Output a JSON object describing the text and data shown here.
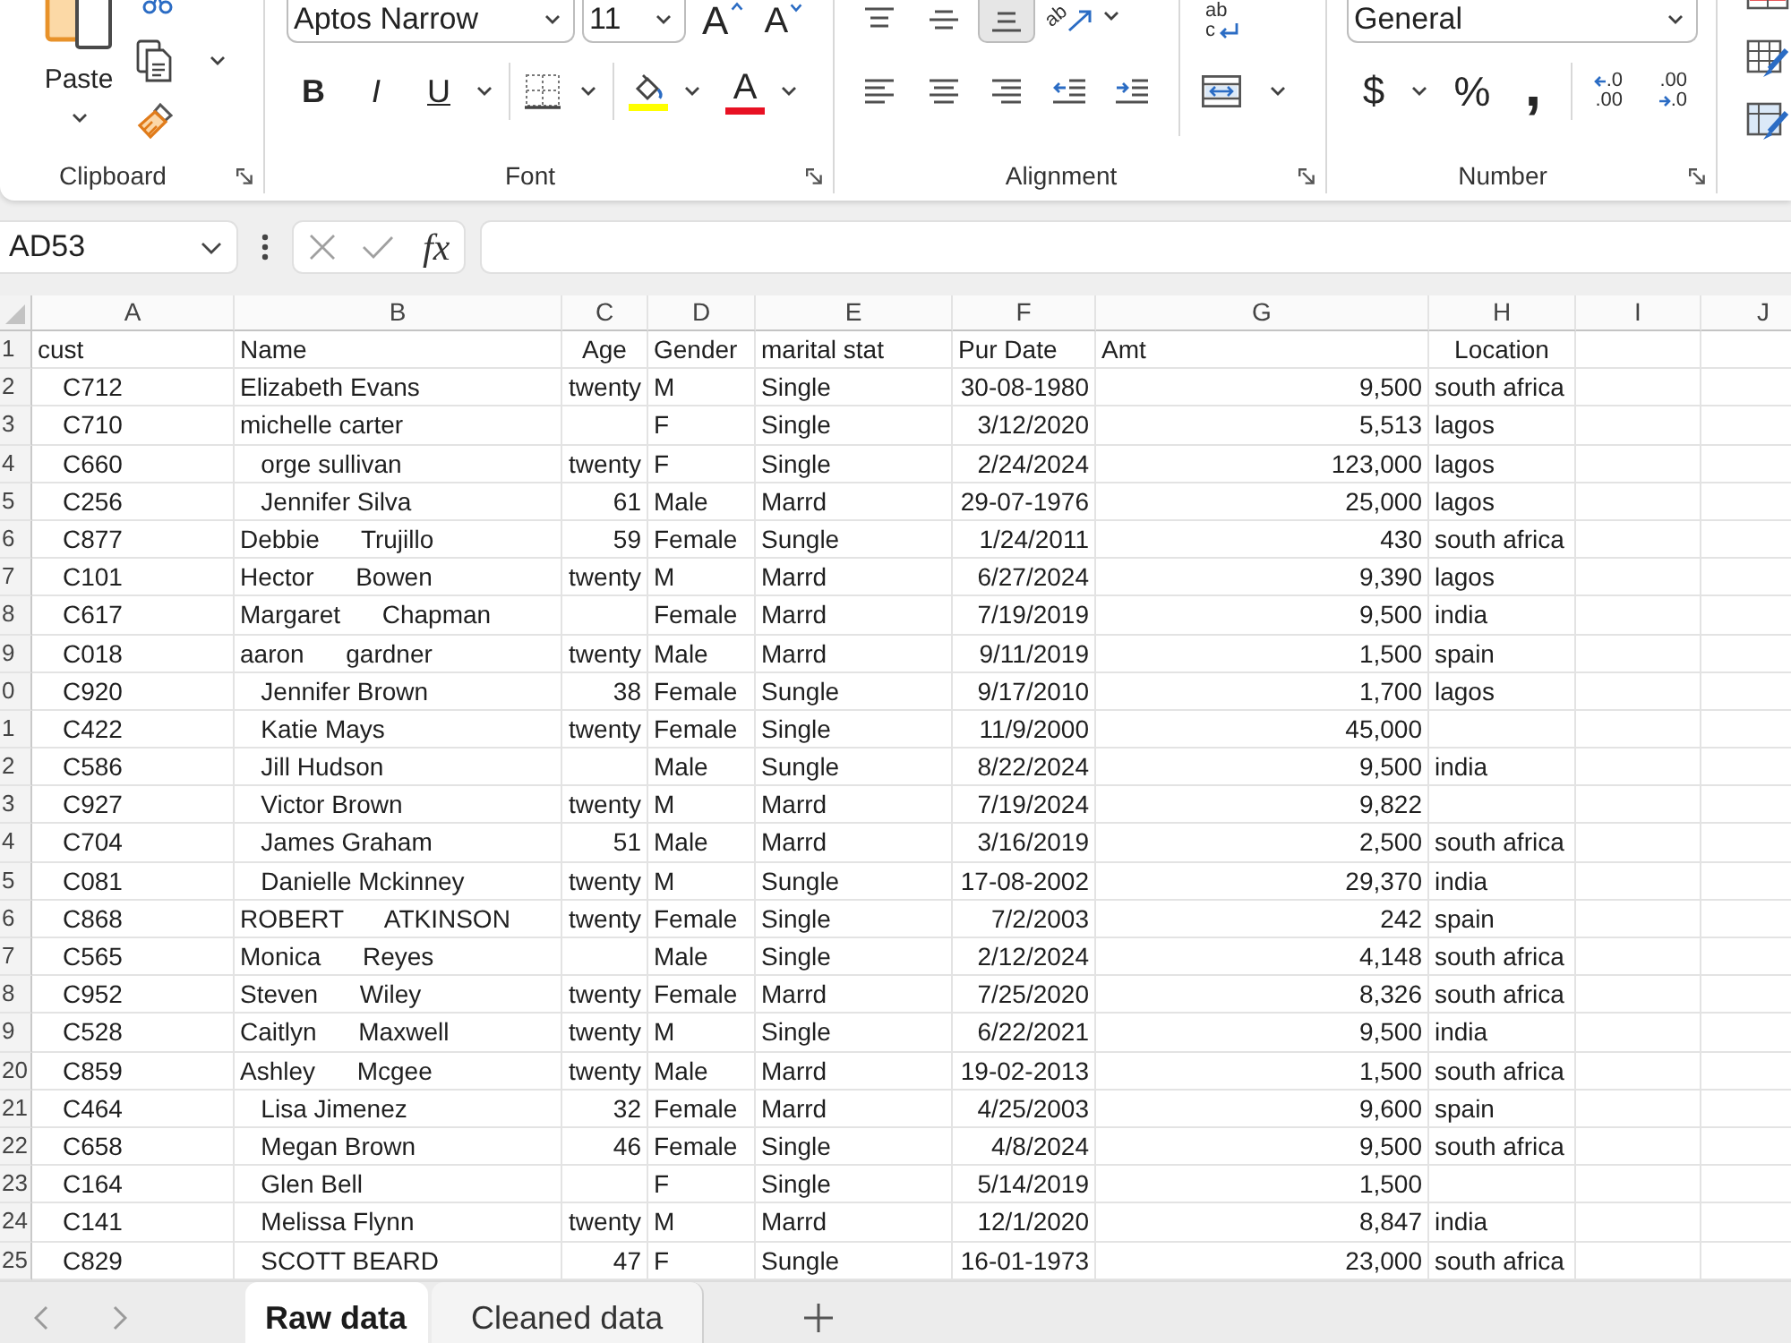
{
  "ribbon": {
    "clipboard": {
      "paste": "Paste",
      "label": "Clipboard"
    },
    "font": {
      "font_name": "Aptos Narrow",
      "font_size": "11",
      "grow_font": "A",
      "shrink_font": "A",
      "bold": "B",
      "italic": "I",
      "underline": "U",
      "font_color": "A",
      "label": "Font"
    },
    "alignment": {
      "vertical": [
        {
          "kind": "top",
          "selected": false
        },
        {
          "kind": "middle",
          "selected": false
        },
        {
          "kind": "bottom",
          "selected": true
        }
      ],
      "orientation": "ab",
      "wrap_text": [
        "ab",
        "c"
      ],
      "horizontal": [
        {
          "kind": "left",
          "selected": false
        },
        {
          "kind": "center",
          "selected": false
        },
        {
          "kind": "right",
          "selected": false
        }
      ],
      "label": "Alignment"
    },
    "number": {
      "format": "General",
      "currency": "$",
      "percent": "%",
      "comma": ",",
      "increase_decimal": [
        ".0",
        ".00"
      ],
      "decrease_decimal": [
        ".00",
        ".0"
      ],
      "label": "Number"
    }
  },
  "formula_bar": {
    "name_box": "AD53",
    "insert_function": "fx"
  },
  "sheet": {
    "columns": [
      "A",
      "B",
      "C",
      "D",
      "E",
      "F",
      "G",
      "H",
      "I",
      "J"
    ],
    "rows": [
      {
        "row": "1",
        "cells": {
          "A": "cust",
          "B": "Name",
          "C": "Age",
          "D": "Gender",
          "E": "marital stat",
          "F": "Pur Date",
          "G": "Amt",
          "H": "Location"
        }
      },
      {
        "row": "2",
        "cells": {
          "A": "C712",
          "B": "Elizabeth Evans",
          "C": "twenty",
          "D": "M",
          "E": "Single",
          "F": "30-08-1980",
          "G": "9,500",
          "H": "south africa"
        }
      },
      {
        "row": "3",
        "cells": {
          "A": "C710",
          "B": "michelle carter",
          "D": "F",
          "E": "Single",
          "F": "3/12/2020",
          "G": "5,513",
          "H": "lagos"
        }
      },
      {
        "row": "4",
        "cells": {
          "A": "C660",
          "B": "   orge sullivan",
          "C": "twenty",
          "D": "F",
          "E": "Single",
          "F": "2/24/2024",
          "G": "123,000",
          "H": "lagos"
        }
      },
      {
        "row": "5",
        "cells": {
          "A": "C256",
          "B": "   Jennifer Silva",
          "C": "61",
          "D": "Male",
          "E": "Marrd",
          "F": "29-07-1976",
          "G": "25,000",
          "H": "lagos"
        }
      },
      {
        "row": "6",
        "cells": {
          "A": "C877",
          "B": "Debbie      Trujillo",
          "C": "59",
          "D": "Female",
          "E": "Sungle",
          "F": "1/24/2011",
          "G": "430",
          "H": "south africa"
        }
      },
      {
        "row": "7",
        "cells": {
          "A": "C101",
          "B": "Hector      Bowen",
          "C": "twenty",
          "D": "M",
          "E": "Marrd",
          "F": "6/27/2024",
          "G": "9,390",
          "H": "lagos"
        }
      },
      {
        "row": "8",
        "cells": {
          "A": "C617",
          "B": "Margaret      Chapman",
          "D": "Female",
          "E": "Marrd",
          "F": "7/19/2019",
          "G": "9,500",
          "H": "india"
        }
      },
      {
        "row": "9",
        "cells": {
          "A": "C018",
          "B": "aaron      gardner",
          "C": "twenty",
          "D": "Male",
          "E": "Marrd",
          "F": "9/11/2019",
          "G": "1,500",
          "H": "spain"
        }
      },
      {
        "row": "0",
        "cells": {
          "A": "C920",
          "B": "   Jennifer Brown",
          "C": "38",
          "D": "Female",
          "E": "Sungle",
          "F": "9/17/2010",
          "G": "1,700",
          "H": "lagos"
        }
      },
      {
        "row": "1",
        "cells": {
          "A": "C422",
          "B": "   Katie Mays",
          "C": "twenty",
          "D": "Female",
          "E": "Single",
          "F": "11/9/2000",
          "G": "45,000"
        }
      },
      {
        "row": "2",
        "cells": {
          "A": "C586",
          "B": "   Jill Hudson",
          "D": "Male",
          "E": "Sungle",
          "F": "8/22/2024",
          "G": "9,500",
          "H": "india"
        }
      },
      {
        "row": "3",
        "cells": {
          "A": "C927",
          "B": "   Victor Brown",
          "C": "twenty",
          "D": "M",
          "E": "Marrd",
          "F": "7/19/2024",
          "G": "9,822"
        }
      },
      {
        "row": "4",
        "cells": {
          "A": "C704",
          "B": "   James Graham",
          "C": "51",
          "D": "Male",
          "E": "Marrd",
          "F": "3/16/2019",
          "G": "2,500",
          "H": "south africa"
        }
      },
      {
        "row": "5",
        "cells": {
          "A": "C081",
          "B": "   Danielle Mckinney",
          "C": "twenty",
          "D": "M",
          "E": "Sungle",
          "F": "17-08-2002",
          "G": "29,370",
          "H": "india"
        }
      },
      {
        "row": "6",
        "cells": {
          "A": "C868",
          "B": "ROBERT      ATKINSON",
          "C": "twenty",
          "D": "Female",
          "E": "Single",
          "F": "7/2/2003",
          "G": "242",
          "H": "spain"
        }
      },
      {
        "row": "7",
        "cells": {
          "A": "C565",
          "B": "Monica      Reyes",
          "D": "Male",
          "E": "Single",
          "F": "2/12/2024",
          "G": "4,148",
          "H": "south africa"
        }
      },
      {
        "row": "8",
        "cells": {
          "A": "C952",
          "B": "Steven      Wiley",
          "C": "twenty",
          "D": "Female",
          "E": "Marrd",
          "F": "7/25/2020",
          "G": "8,326",
          "H": "south africa"
        }
      },
      {
        "row": "9",
        "cells": {
          "A": "C528",
          "B": "Caitlyn      Maxwell",
          "C": "twenty",
          "D": "M",
          "E": "Single",
          "F": "6/22/2021",
          "G": "9,500",
          "H": "india"
        }
      },
      {
        "row": "20",
        "cells": {
          "A": "C859",
          "B": "Ashley      Mcgee",
          "C": "twenty",
          "D": "Male",
          "E": "Marrd",
          "F": "19-02-2013",
          "G": "1,500",
          "H": "south africa"
        }
      },
      {
        "row": "21",
        "cells": {
          "A": "C464",
          "B": "   Lisa Jimenez",
          "C": "32",
          "D": "Female",
          "E": "Marrd",
          "F": "4/25/2003",
          "G": "9,600",
          "H": "spain"
        }
      },
      {
        "row": "22",
        "cells": {
          "A": "C658",
          "B": "   Megan Brown",
          "C": "46",
          "D": "Female",
          "E": "Single",
          "F": "4/8/2024",
          "G": "9,500",
          "H": "south africa"
        }
      },
      {
        "row": "23",
        "cells": {
          "A": "C164",
          "B": "   Glen Bell",
          "D": "F",
          "E": "Single",
          "F": "5/14/2019",
          "G": "1,500"
        }
      },
      {
        "row": "24",
        "cells": {
          "A": "C141",
          "B": "   Melissa Flynn",
          "C": "twenty",
          "D": "M",
          "E": "Marrd",
          "F": "12/1/2020",
          "G": "8,847",
          "H": "india"
        }
      },
      {
        "row": "25",
        "cells": {
          "A": "C829",
          "B": "   SCOTT BEARD",
          "C": "47",
          "D": "F",
          "E": "Sungle",
          "F": "16-01-1973",
          "G": "23,000",
          "H": "south africa"
        }
      }
    ]
  },
  "sheet_tabs": [
    {
      "label": "Raw data",
      "selected": true
    },
    {
      "label": "Cleaned data",
      "selected": false
    }
  ]
}
